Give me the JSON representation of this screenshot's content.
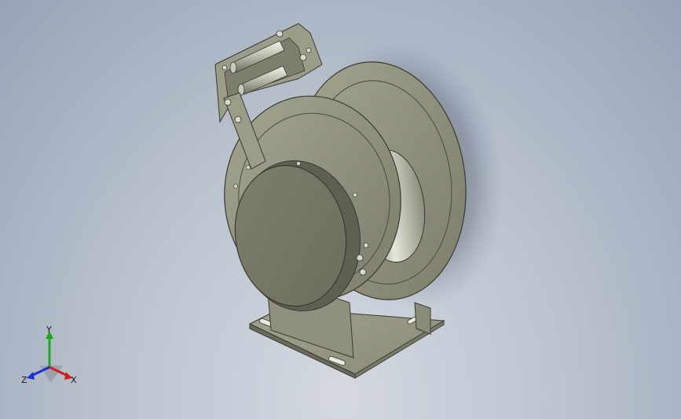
{
  "viewport": {
    "background_top": "#97a4b6",
    "background_bottom": "#d4d9e1",
    "model_color": "#8a8b78",
    "edge_color": "#3a3a32"
  },
  "triad": {
    "x_label": "X",
    "y_label": "Y",
    "z_label": "Z",
    "x_color": "#d21e1e",
    "y_color": "#1ea81e",
    "z_color": "#1e2ed2"
  }
}
